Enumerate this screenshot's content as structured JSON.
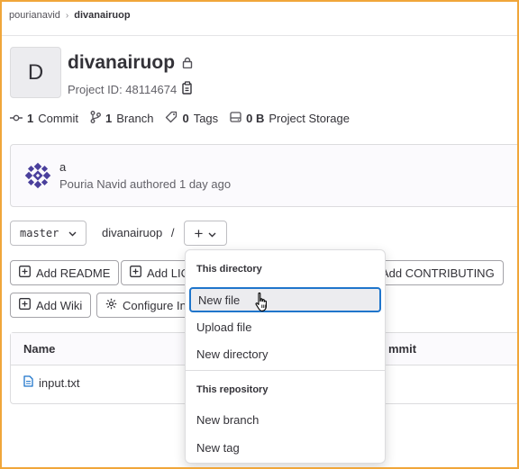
{
  "breadcrumb": {
    "parent": "pourianavid",
    "separator": "›",
    "current": "divanairuop"
  },
  "project": {
    "avatar_letter": "D",
    "name": "divanairuop",
    "id_label": "Project ID: 48114674"
  },
  "stats": {
    "commits": {
      "count": "1",
      "label": "Commit"
    },
    "branches": {
      "count": "1",
      "label": "Branch"
    },
    "tags": {
      "count": "0",
      "label": "Tags"
    },
    "storage": {
      "count": "0 B",
      "label": "Project Storage"
    }
  },
  "last_commit": {
    "title": "a",
    "meta": "Pouria Navid authored 1 day ago"
  },
  "repo_nav": {
    "branch": "master",
    "path": "divanairuop",
    "path_sep": "/",
    "add_symbol": "+"
  },
  "quick_actions": {
    "add_readme": "Add README",
    "add_license": "Add LIC",
    "add_contributing": "Add CONTRIBUTING",
    "add_wiki": "Add Wiki",
    "configure_integrations": "Configure In"
  },
  "file_table": {
    "headers": {
      "name": "Name",
      "last_commit": "mmit"
    },
    "rows": [
      {
        "name": "input.txt"
      }
    ]
  },
  "add_menu": {
    "section_directory": "This directory",
    "new_file": "New file",
    "upload_file": "Upload file",
    "new_directory": "New directory",
    "section_repository": "This repository",
    "new_branch": "New branch",
    "new_tag": "New tag"
  },
  "colors": {
    "frame_border": "#f0a63a",
    "focus_ring": "#1f75cb",
    "file_icon": "#1f75cb"
  }
}
